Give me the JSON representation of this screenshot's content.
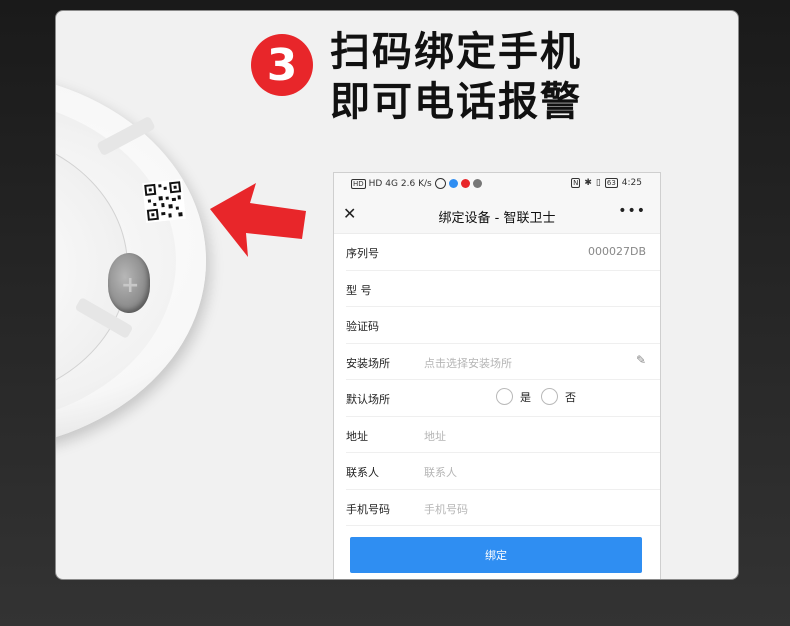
{
  "heading": {
    "step_number": "3",
    "line1": "扫码绑定手机",
    "line2": "即可电话报警"
  },
  "colors": {
    "accent_red": "#e8262a",
    "button_blue": "#2f8ef2"
  },
  "phone": {
    "status_bar": {
      "left_indicators": "HD 4G",
      "speed": "2.6 K/s",
      "battery": "63",
      "time": "4:25"
    },
    "app_bar": {
      "close_icon": "close-icon",
      "title": "绑定设备 - 智联卫士",
      "more_icon": "more-dots-icon"
    },
    "form": {
      "serial": {
        "label": "序列号",
        "value": "000027DB"
      },
      "model": {
        "label": "型 号"
      },
      "verify": {
        "label": "验证码"
      },
      "location": {
        "label": "安装场所",
        "placeholder": "点击选择安装场所"
      },
      "default_location": {
        "label": "默认场所",
        "yes": "是",
        "no": "否"
      },
      "address": {
        "label": "地址",
        "placeholder": "地址"
      },
      "contact": {
        "label": "联系人",
        "placeholder": "联系人"
      },
      "phone": {
        "label": "手机号码",
        "placeholder": "手机号码"
      }
    },
    "bind_button": "绑定"
  }
}
